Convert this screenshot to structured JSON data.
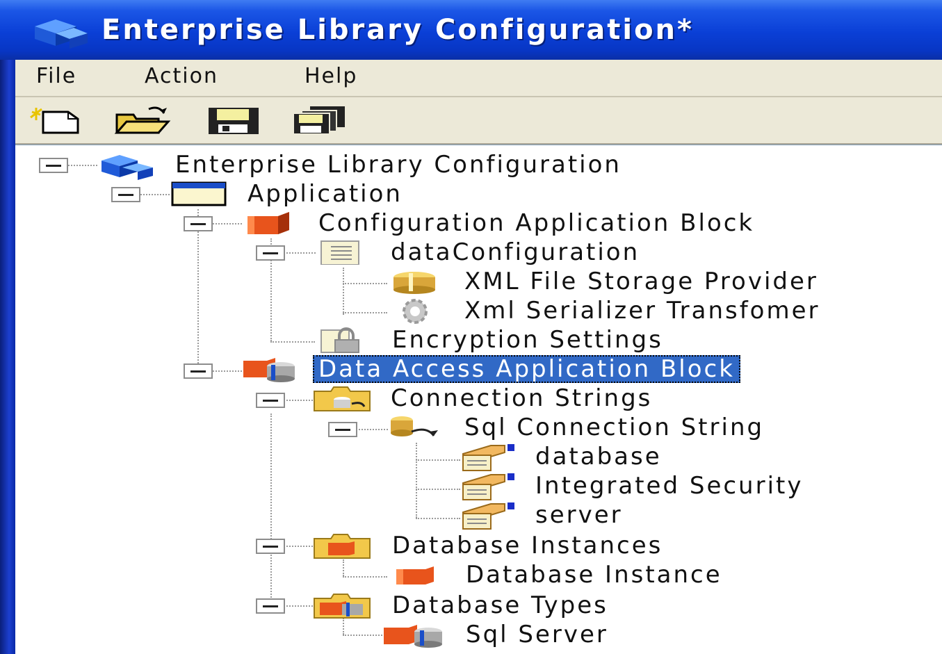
{
  "window": {
    "title": "Enterprise Library Configuration*"
  },
  "menu": {
    "items": [
      "File",
      "Action",
      "Help"
    ]
  },
  "toolbar": {
    "buttons": [
      "new-icon",
      "open-icon",
      "save-icon",
      "save-all-icon"
    ]
  },
  "tree": {
    "nodes": [
      {
        "label": "Enterprise Library Configuration",
        "icon": "enterprise-library-icon",
        "level": 0,
        "expanded": true,
        "selected": false
      },
      {
        "label": "Application",
        "icon": "application-window-icon",
        "level": 1,
        "expanded": true,
        "selected": false
      },
      {
        "label": "Configuration Application Block",
        "icon": "configuration-block-icon",
        "level": 2,
        "expanded": true,
        "selected": false
      },
      {
        "label": "dataConfiguration",
        "icon": "config-section-icon",
        "level": 3,
        "expanded": true,
        "selected": false
      },
      {
        "label": "XML File Storage Provider",
        "icon": "storage-provider-icon",
        "level": 4,
        "selected": false
      },
      {
        "label": "Xml Serializer Transfomer",
        "icon": "transformer-gear-icon",
        "level": 4,
        "selected": false
      },
      {
        "label": "Encryption Settings",
        "icon": "lock-icon",
        "level": 3,
        "selected": false
      },
      {
        "label": "Data Access Application Block",
        "icon": "data-access-block-icon",
        "level": 2,
        "expanded": true,
        "selected": true
      },
      {
        "label": "Connection Strings",
        "icon": "connection-strings-folder-icon",
        "level": 3,
        "expanded": true,
        "selected": false
      },
      {
        "label": "Sql Connection String",
        "icon": "connection-string-icon",
        "level": 4,
        "expanded": true,
        "selected": false
      },
      {
        "label": "database",
        "icon": "parameter-icon",
        "level": 5,
        "selected": false
      },
      {
        "label": "Integrated Security",
        "icon": "parameter-icon",
        "level": 5,
        "selected": false
      },
      {
        "label": "server",
        "icon": "parameter-icon",
        "level": 5,
        "selected": false
      },
      {
        "label": "Database Instances",
        "icon": "database-instances-folder-icon",
        "level": 3,
        "expanded": true,
        "selected": false
      },
      {
        "label": "Database Instance",
        "icon": "database-instance-icon",
        "level": 4,
        "selected": false
      },
      {
        "label": "Database Types",
        "icon": "database-types-folder-icon",
        "level": 3,
        "expanded": true,
        "selected": false
      },
      {
        "label": "Sql Server",
        "icon": "sql-server-icon",
        "level": 4,
        "selected": false
      }
    ]
  },
  "colors": {
    "titlebar": "#0a3fd6",
    "selection": "#3169c6",
    "chrome": "#ece9d8"
  }
}
